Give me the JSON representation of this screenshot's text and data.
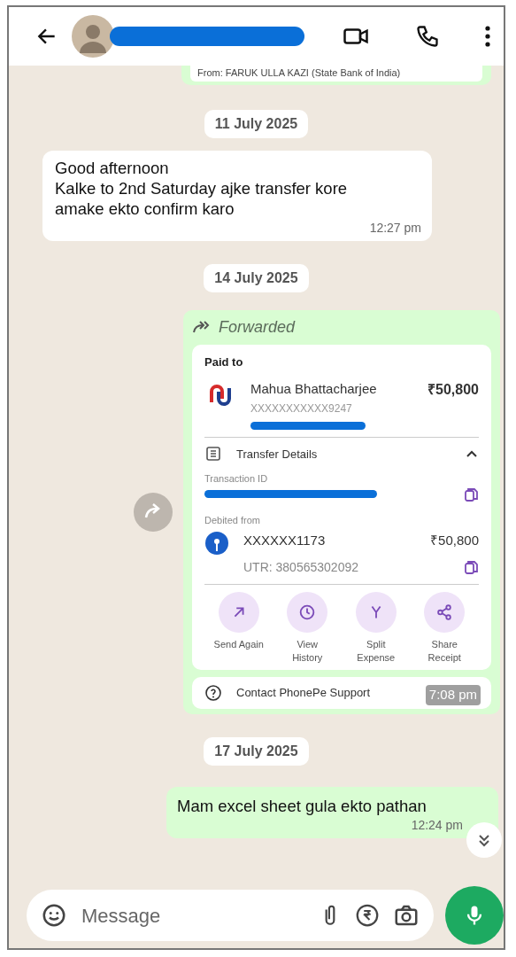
{
  "top_snippet": "From: FARUK ULLA  KAZI (State Bank of India)",
  "messages": [
    {
      "kind": "date",
      "text": "11 July 2025"
    },
    {
      "kind": "incoming",
      "text": "Good afternoon\nKalke to 2nd Saturday ajke transfer kore\namake ekto confirm karo",
      "time": "12:27 pm"
    },
    {
      "kind": "date",
      "text": "14 July 2025"
    },
    {
      "kind": "payment",
      "forwarded": "Forwarded",
      "paid_to": "Paid to",
      "payee": "Mahua Bhattacharjee",
      "amount": "₹50,800",
      "account": "XXXXXXXXXXX9247",
      "transfer_details": {
        "label": "Transfer Details",
        "expanded": true
      },
      "transaction_id_label": "Transaction ID",
      "debited_from_label": "Debited from",
      "debit_account": "XXXXXX1173",
      "debit_amount": "₹50,800",
      "utr": "UTR: 380565302092",
      "actions": [
        {
          "label": "Send Again",
          "kind": "send"
        },
        {
          "label": "View\nHistory",
          "kind": "history"
        },
        {
          "label": "Split\nExpense",
          "kind": "split"
        },
        {
          "label": "Share\nReceipt",
          "kind": "share"
        }
      ],
      "support": "Contact PhonePe Support",
      "time": "7:08 pm"
    },
    {
      "kind": "date",
      "text": "17 July 2025"
    },
    {
      "kind": "outgoing",
      "text": "Mam excel sheet gula ekto pathan",
      "time": "12:24 pm"
    }
  ],
  "composer": {
    "placeholder": "Message"
  }
}
